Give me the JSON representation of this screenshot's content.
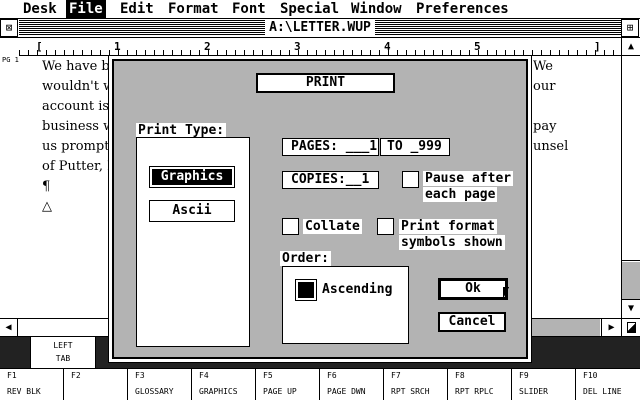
{
  "menubar": {
    "items": [
      "Desk",
      "File",
      "Edit",
      "Format",
      "Font",
      "Special",
      "Window",
      "Preferences"
    ],
    "active": "File"
  },
  "window": {
    "title": "A:\\LETTER.WUP",
    "close_glyph": "⊠",
    "full_glyph": "⊞"
  },
  "ruler": {
    "marks": [
      "[",
      "1",
      "2",
      "3",
      "4",
      "5",
      "6",
      "]"
    ]
  },
  "document": {
    "page_marker": "PG 1",
    "lines": [
      "We have be",
      "wouldn't w",
      "account is r",
      "business wi",
      "us promptly",
      "of Putter, M",
      "¶",
      "△"
    ],
    "right_fragments": [
      "We",
      "our",
      "",
      "pay",
      "unsel"
    ]
  },
  "tabstrip": {
    "label_1": "LEFT",
    "label_2": "TAB"
  },
  "function_keys": [
    {
      "key": "F1",
      "label": "REV BLK"
    },
    {
      "key": "F2",
      "label": ""
    },
    {
      "key": "F3",
      "label": "GLOSSARY"
    },
    {
      "key": "F4",
      "label": "GRAPHICS"
    },
    {
      "key": "F5",
      "label": "PAGE UP"
    },
    {
      "key": "F6",
      "label": "PAGE DWN"
    },
    {
      "key": "F7",
      "label": "RPT SRCH"
    },
    {
      "key": "F8",
      "label": "RPT RPLC"
    },
    {
      "key": "F9",
      "label": "SLIDER"
    },
    {
      "key": "F10",
      "label": "DEL LINE"
    }
  ],
  "dialog": {
    "title": "PRINT",
    "print_type_label": "Print Type:",
    "print_type_options": [
      "Graphics",
      "Ascii"
    ],
    "print_type_selected": "Graphics",
    "pages_label": "PAGES: ___1",
    "to_label": "TO _999",
    "copies_label": "COPIES:__1",
    "pause_line1": "Pause after",
    "pause_line2": "each page",
    "collate_label": "Collate",
    "format_line1": "Print format",
    "format_line2": "symbols shown",
    "order_label": "Order:",
    "order_value": "Ascending",
    "ok_label": "Ok",
    "cancel_label": "Cancel"
  }
}
